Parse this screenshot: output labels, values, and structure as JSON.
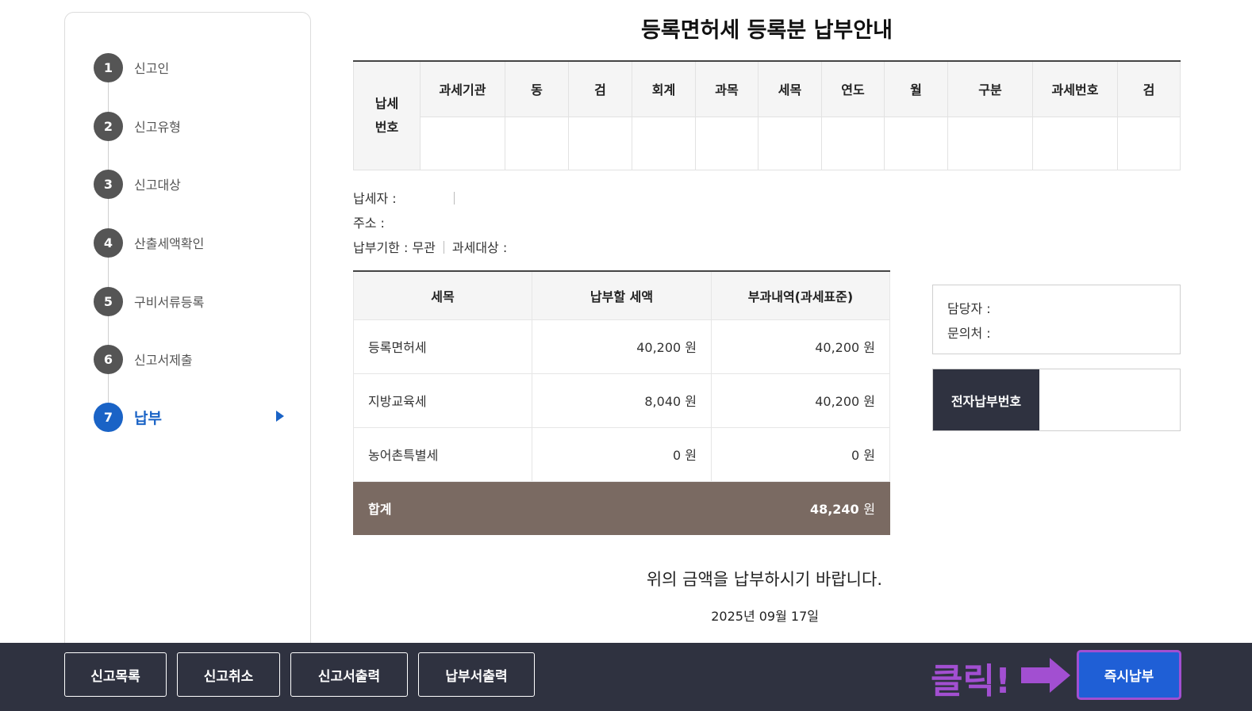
{
  "sidebar": {
    "steps": [
      {
        "num": "1",
        "label": "신고인"
      },
      {
        "num": "2",
        "label": "신고유형"
      },
      {
        "num": "3",
        "label": "신고대상"
      },
      {
        "num": "4",
        "label": "산출세액확인"
      },
      {
        "num": "5",
        "label": "구비서류등록"
      },
      {
        "num": "6",
        "label": "신고서제출"
      },
      {
        "num": "7",
        "label": "납부"
      }
    ],
    "active_step": "7"
  },
  "main": {
    "title": "등록면허세 등록분 납부안내",
    "tax_number_table": {
      "row_header": "납세\n번호",
      "columns": [
        "과세기관",
        "동",
        "검",
        "회계",
        "과목",
        "세목",
        "연도",
        "월",
        "구분",
        "과세번호",
        "검"
      ]
    },
    "info": {
      "payer_label": "납세자 :",
      "address_label": "주소 :",
      "due_label": "납부기한 : 무관",
      "target_label": "과세대상 :"
    },
    "payment_table": {
      "headers": [
        "세목",
        "납부할 세액",
        "부과내역(과세표준)"
      ],
      "rows": [
        {
          "item": "등록면허세",
          "amount": "40,200 원",
          "basis": "40,200 원"
        },
        {
          "item": "지방교육세",
          "amount": "8,040 원",
          "basis": "40,200 원"
        },
        {
          "item": "농어촌특별세",
          "amount": "0 원",
          "basis": "0 원"
        }
      ],
      "total_label": "합계",
      "total_value": "48,240",
      "total_unit": "원"
    },
    "contact": {
      "manager_label": "담당자 :",
      "inquiry_label": "문의처 :"
    },
    "epay_label": "전자납부번호",
    "notice": "위의 금액을 납부하시기 바랍니다.",
    "date": "2025년 09월 17일"
  },
  "bottom_bar": {
    "buttons": [
      "신고목록",
      "신고취소",
      "신고서출력",
      "납부서출력"
    ],
    "click_hint": "클릭!",
    "primary_button": "즉시납부"
  },
  "colors": {
    "accent_blue": "#1a63c6",
    "total_row": "#7a6a62",
    "bar_bg": "#2f3240",
    "highlight_purple": "#a24fd1"
  }
}
